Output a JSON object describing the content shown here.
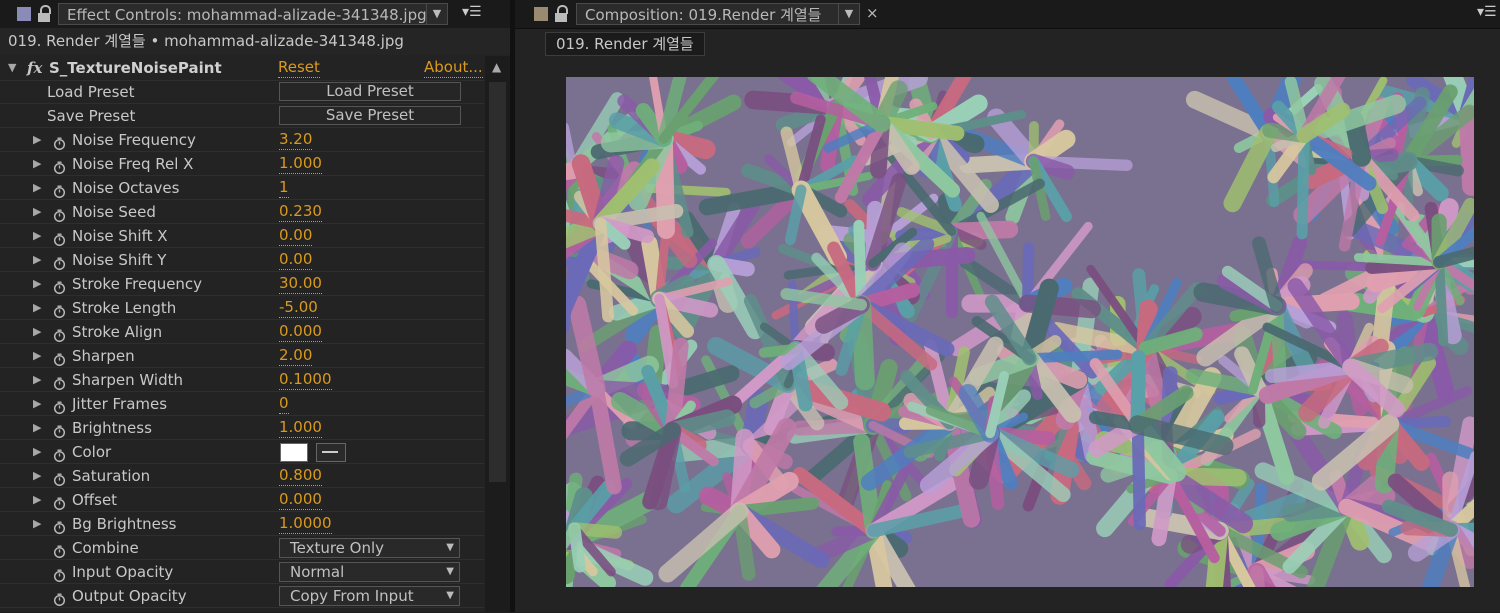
{
  "left_panel": {
    "tab_title": "Effect Controls: mohammad-alizade-341348.jpg",
    "panel_color": "#8b8bb8",
    "subheader": "019. Render 계열들 • mohammad-alizade-341348.jpg",
    "effect": {
      "fx_label": "fx",
      "name": "S_TextureNoisePaint",
      "reset_label": "Reset",
      "about_label": "About..."
    },
    "preset_rows": [
      {
        "label": "Load Preset",
        "button": "Load Preset"
      },
      {
        "label": "Save Preset",
        "button": "Save Preset"
      }
    ],
    "params": [
      {
        "label": "Noise Frequency",
        "value": "3.20"
      },
      {
        "label": "Noise Freq Rel X",
        "value": "1.000"
      },
      {
        "label": "Noise Octaves",
        "value": "1"
      },
      {
        "label": "Noise Seed",
        "value": "0.230"
      },
      {
        "label": "Noise Shift X",
        "value": "0.00"
      },
      {
        "label": "Noise Shift Y",
        "value": "0.00"
      },
      {
        "label": "Stroke Frequency",
        "value": "30.00"
      },
      {
        "label": "Stroke Length",
        "value": "-5.00"
      },
      {
        "label": "Stroke Align",
        "value": "0.000"
      },
      {
        "label": "Sharpen",
        "value": "2.00"
      },
      {
        "label": "Sharpen Width",
        "value": "0.1000"
      },
      {
        "label": "Jitter Frames",
        "value": "0"
      },
      {
        "label": "Brightness",
        "value": "1.000"
      }
    ],
    "color_param": {
      "label": "Color",
      "color": "#ffffff"
    },
    "params2": [
      {
        "label": "Saturation",
        "value": "0.800"
      },
      {
        "label": "Offset",
        "value": "0.000"
      },
      {
        "label": "Bg Brightness",
        "value": "1.0000"
      }
    ],
    "dropdown_params": [
      {
        "label": "Combine",
        "value": "Texture Only"
      },
      {
        "label": "Input Opacity",
        "value": "Normal"
      },
      {
        "label": "Output Opacity",
        "value": "Copy From Input"
      }
    ]
  },
  "right_panel": {
    "tab_title": "Composition: 019.Render 계열들",
    "panel_color": "#9a8a70",
    "close_glyph": "×",
    "breadcrumb": "019. Render 계열들"
  },
  "accent_color": "#d99a1d"
}
